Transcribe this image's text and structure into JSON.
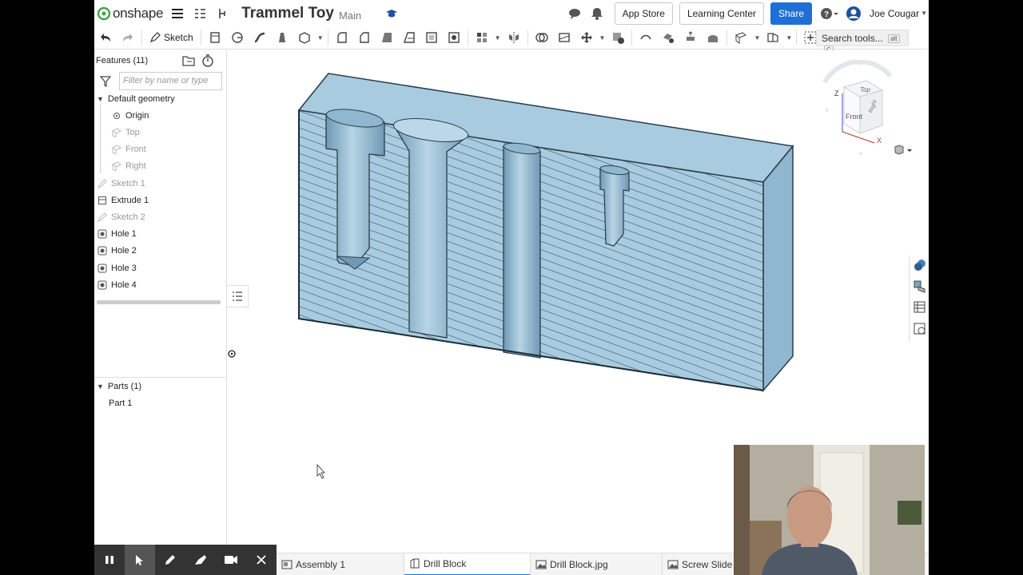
{
  "app": {
    "logo_text": "onshape",
    "doc_title": "Trammel Toy",
    "branch": "Main"
  },
  "topbar": {
    "notification_count": "3",
    "app_store_label": "App Store",
    "learning_center_label": "Learning Center",
    "share_label": "Share",
    "user_name": "Joe Cougar"
  },
  "toolbar": {
    "sketch_label": "Sketch",
    "search_label": "Search tools...",
    "search_shortcut_1": "alt",
    "search_shortcut_2": "C"
  },
  "feature_panel": {
    "title": "Features (11)",
    "filter_placeholder": "Filter by name or type",
    "default_geometry_label": "Default geometry",
    "items": [
      {
        "label": "Origin",
        "icon": "origin-icon",
        "dim": false
      },
      {
        "label": "Top",
        "icon": "plane-icon",
        "dim": true
      },
      {
        "label": "Front",
        "icon": "plane-icon",
        "dim": true
      },
      {
        "label": "Right",
        "icon": "plane-icon",
        "dim": true
      },
      {
        "label": "Sketch 1",
        "icon": "sketch-icon",
        "dim": true
      },
      {
        "label": "Extrude 1",
        "icon": "extrude-icon",
        "dim": false
      },
      {
        "label": "Sketch 2",
        "icon": "sketch-icon",
        "dim": true
      },
      {
        "label": "Hole 1",
        "icon": "hole-icon",
        "dim": false
      },
      {
        "label": "Hole 2",
        "icon": "hole-icon",
        "dim": false
      },
      {
        "label": "Hole 3",
        "icon": "hole-icon",
        "dim": false
      },
      {
        "label": "Hole 4",
        "icon": "hole-icon",
        "dim": false
      }
    ],
    "parts_label": "Parts (1)",
    "parts": [
      "Part 1"
    ]
  },
  "view_cube": {
    "top_label": "Top",
    "front_label": "Front",
    "right_label": "Right",
    "z_label": "Z",
    "x_label": "X"
  },
  "tabs": [
    {
      "label": "Assembly 1",
      "icon": "assembly-icon",
      "active": false
    },
    {
      "label": "Drill Block",
      "icon": "part-studio-icon",
      "active": true
    },
    {
      "label": "Drill Block.jpg",
      "icon": "image-icon",
      "active": false
    },
    {
      "label": "Screw Slide",
      "icon": "image-icon",
      "active": false
    }
  ],
  "colors": {
    "accent": "#1f6fd6",
    "part_face": "#a8cbe0",
    "part_dark": "#7fa9c2"
  }
}
